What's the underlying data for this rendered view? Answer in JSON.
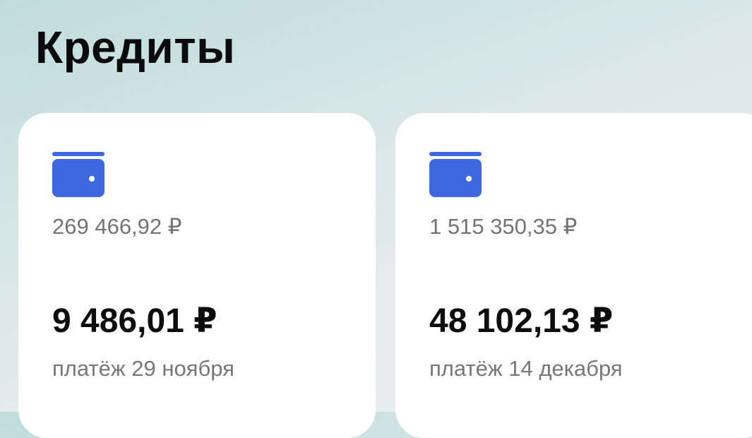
{
  "header": {
    "title": "Кредиты"
  },
  "colors": {
    "accent": "#3d68e0",
    "background_top": "#bfdcdb",
    "card": "#ffffff"
  },
  "credits": [
    {
      "icon": "wallet-icon",
      "balance": "269 466,92 ₽",
      "payment_amount": "9 486,01 ₽",
      "payment_date": "платёж 29 ноября"
    },
    {
      "icon": "wallet-icon",
      "balance": "1 515 350,35 ₽",
      "payment_amount": "48 102,13 ₽",
      "payment_date": "платёж 14 декабря"
    }
  ]
}
